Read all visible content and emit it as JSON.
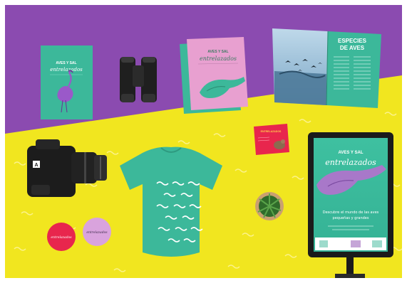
{
  "colors": {
    "frame": "#ffffff",
    "purple_surface": "#8b4bb0",
    "yellow_surface": "#f1e61f",
    "teal": "#3cb89a",
    "pink": "#e8a0d0",
    "red": "#e8264d",
    "lavender": "#d9a3dd",
    "ink_dark": "#1b1b1b"
  },
  "book_left": {
    "title": "AVES Y SAL",
    "script": "entrelazados"
  },
  "book_pink": {
    "title": "AVES Y SAL",
    "script": "entrelazados"
  },
  "magazine": {
    "heading_line1": "ESPECIES",
    "heading_line2": "DE AVES"
  },
  "flyer": {
    "title": "ENTRELAZADOS"
  },
  "buttons": {
    "pink_button_text": "entrelazados",
    "red_button_text": "entrelazados"
  },
  "poster": {
    "title": "AVES Y SAL",
    "script": "entrelazados",
    "body_line1": "Descubre el mundo de las aves",
    "body_line2": "pequeñas y grandes"
  },
  "camera": {
    "brand_badge": "A"
  },
  "icons": [
    "camera-icon",
    "binoculars-icon",
    "plant-icon",
    "bird-icon",
    "flamingo-icon",
    "pelican-icon",
    "tshirt-icon"
  ]
}
